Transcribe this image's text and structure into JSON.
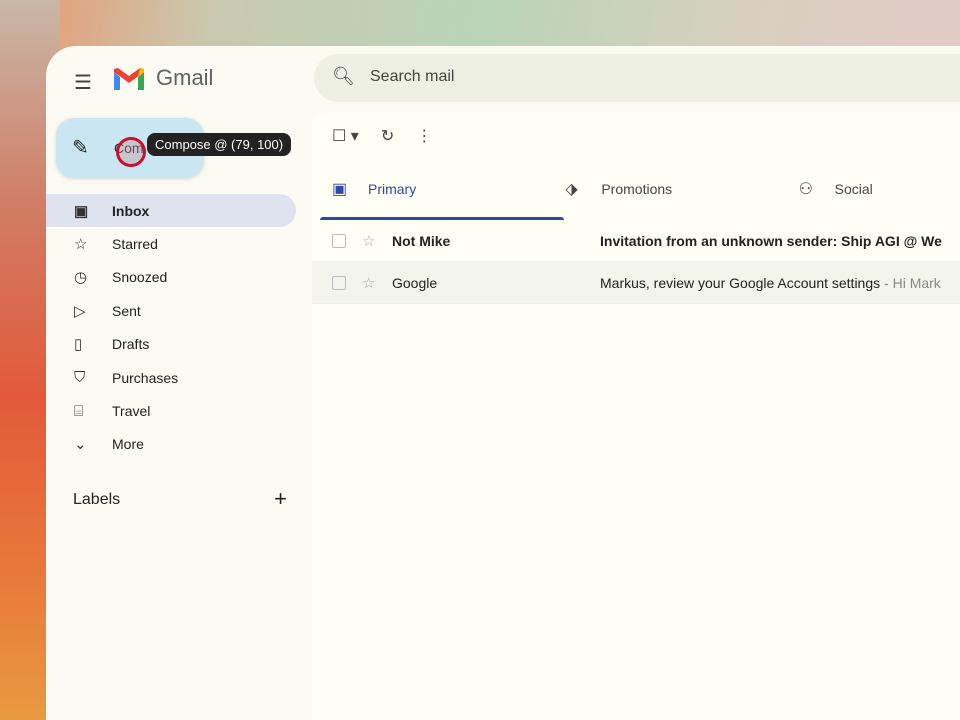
{
  "app": {
    "brand": "Gmail"
  },
  "search": {
    "placeholder": "Search mail"
  },
  "compose": {
    "label": "Com",
    "tooltip": "Compose @ (79, 100)"
  },
  "nav": [
    {
      "label": "Inbox",
      "icon": "inbox-icon",
      "active": true
    },
    {
      "label": "Starred",
      "icon": "star-icon"
    },
    {
      "label": "Snoozed",
      "icon": "clock-icon"
    },
    {
      "label": "Sent",
      "icon": "send-icon"
    },
    {
      "label": "Drafts",
      "icon": "draft-icon"
    },
    {
      "label": "Purchases",
      "icon": "bag-icon"
    },
    {
      "label": "Travel",
      "icon": "luggage-icon"
    },
    {
      "label": "More",
      "icon": "chevron-down-icon"
    }
  ],
  "labels": {
    "title": "Labels",
    "add": "+"
  },
  "tabs": [
    {
      "label": "Primary"
    },
    {
      "label": "Promotions"
    },
    {
      "label": "Social"
    }
  ],
  "emails": [
    {
      "from": "Not Mike",
      "subject": "Invitation from an unknown sender: Ship AGI @ We",
      "snippet": "",
      "unread": true
    },
    {
      "from": "Google",
      "subject": "Markus, review your Google Account settings",
      "snippet": " - Hi Mark",
      "unread": false
    }
  ],
  "colors": {
    "accent": "#2b4aa8",
    "compose": "#c9e6f2"
  }
}
